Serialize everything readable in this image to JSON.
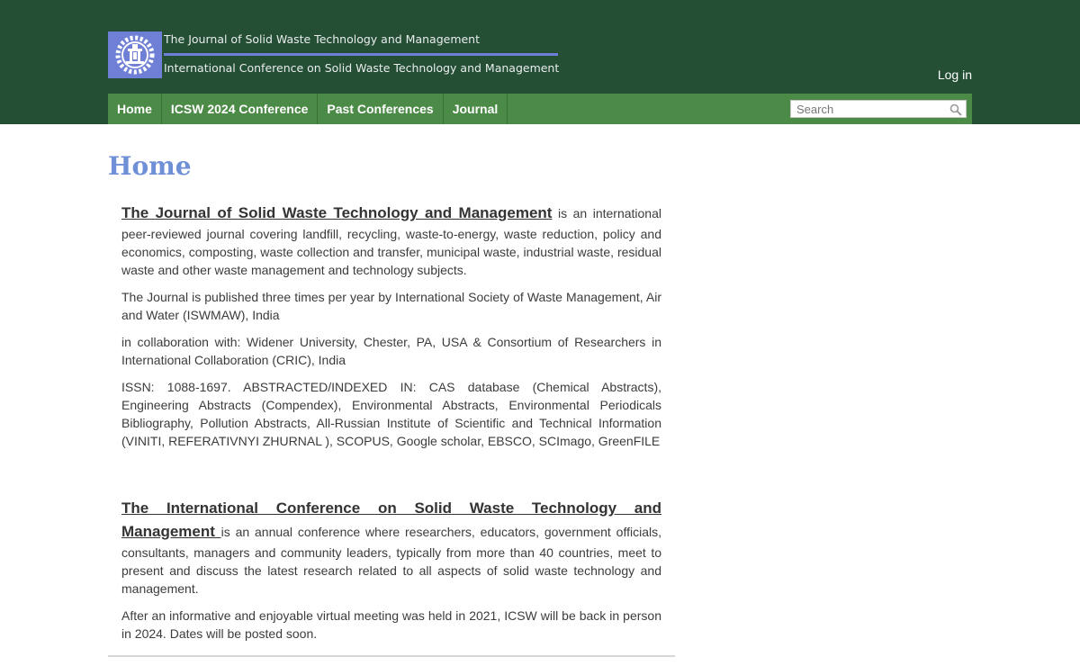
{
  "header": {
    "site_title": "The Journal of Solid Waste Technology and Management",
    "site_subtitle": "International Conference on Solid Waste Technology and Management",
    "login_label": "Log in",
    "logo_icon": "gear-emblem-icon",
    "bg_color": "#254f35"
  },
  "nav": {
    "items": [
      {
        "label": "Home"
      },
      {
        "label": "ICSW 2024 Conference"
      },
      {
        "label": "Past Conferences"
      },
      {
        "label": "Journal"
      }
    ],
    "bar_color": "#4c8a47"
  },
  "search": {
    "placeholder": "Search",
    "icon": "search-icon"
  },
  "main": {
    "page_title": "Home",
    "journal": {
      "link": "The Journal of Solid Waste Technology and Management",
      "intro": " is an international peer-reviewed journal covering landfill, recycling, waste-to-energy, waste reduction, policy and economics, composting, waste collection and transfer, municipal waste, industrial waste, residual waste and other waste management and technology subjects.",
      "published": "The Journal is published three times per year by International Society of Waste Management, Air and Water (ISWMAW), India",
      "collaboration": "in collaboration with: Widener University, Chester, PA, USA & Consortium of Researchers in International Collaboration (CRIC), India",
      "issn": "ISSN: 1088-1697.     ABSTRACTED/INDEXED IN:  CAS database (Chemical Abstracts), Engineering Abstracts (Compendex), Environmental Abstracts, Environmental Periodicals Bibliography, Pollution Abstracts, All-Russian Institute of Scientific and Technical Information (VINITI, REFERATIVNYI ZHURNAL ), SCOPUS, Google scholar, EBSCO, SCImago, GreenFILE"
    },
    "conference": {
      "link": "The International Conference on Solid Waste Technology and Management ",
      "intro": "is an annual conference where researchers, educators, government officials, consultants, managers and community leaders, typically from more than 40 countries, meet to present and discuss the latest research related to all aspects of solid waste technology and management.",
      "update": "After an informative and enjoyable virtual meeting was held in 2021, ICSW will be back in person in 2024.  Dates will be posted soon."
    }
  }
}
